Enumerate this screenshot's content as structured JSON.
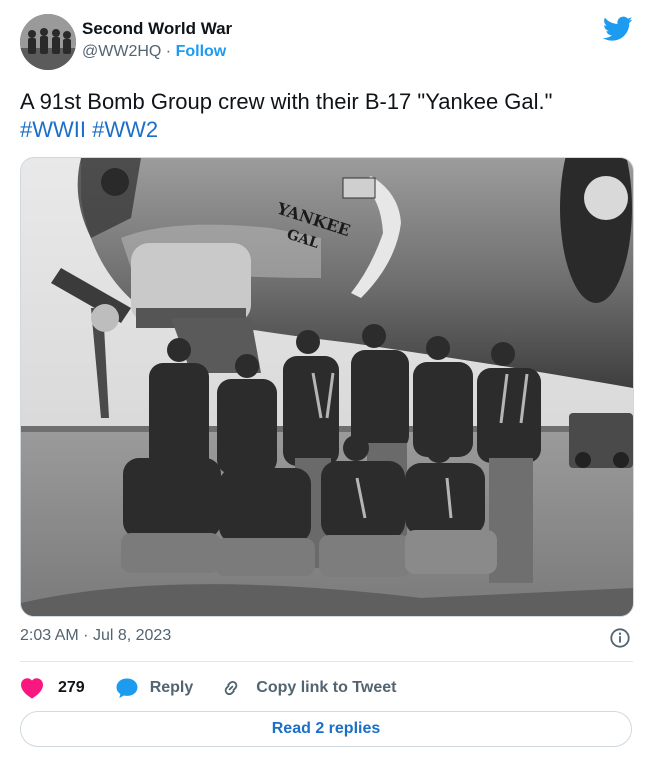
{
  "author": {
    "display_name": "Second World War",
    "handle": "@WW2HQ",
    "separator": "·",
    "follow_label": "Follow",
    "avatar_icon": "soldiers-avatar-icon"
  },
  "brand": {
    "icon": "twitter-bird-icon",
    "color": "#1d9bf0"
  },
  "tweet": {
    "text": "A 91st Bomb Group crew with their B-17 \"Yankee Gal.\"",
    "hashtags": [
      "#WWII",
      "#WW2"
    ],
    "hashtag_color": "#1b6fc7"
  },
  "photo": {
    "nose_art_line1": "YANKEE",
    "nose_art_line2": "GAL"
  },
  "meta": {
    "time": "2:03 AM",
    "separator": "·",
    "date": "Jul 8, 2023",
    "info_icon": "info-icon"
  },
  "actions": {
    "like_count": "279",
    "like_color": "#f91880",
    "reply_label": "Reply",
    "copy_label": "Copy link to Tweet"
  },
  "footer": {
    "read_replies_label": "Read 2 replies"
  }
}
